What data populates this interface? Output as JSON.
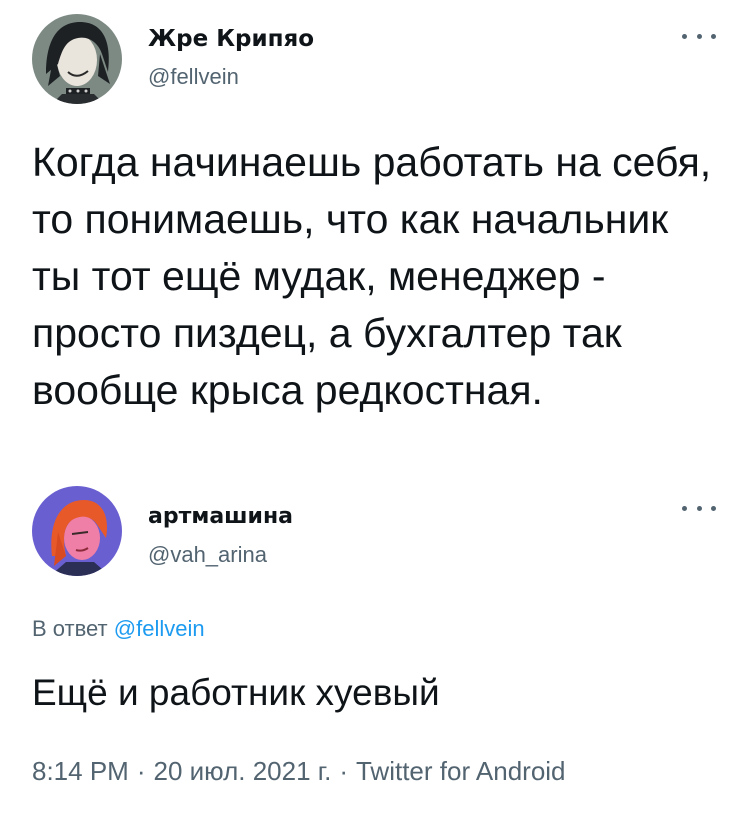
{
  "tweet": {
    "author": {
      "display_name": "Жре Крипяо",
      "handle": "@fellvein",
      "avatar_icon": "avatar-dark-haired-character"
    },
    "more_icon": "more-options-dots-icon",
    "text": "Когда начинаешь работать на себя, то понимаешь, что как начальник ты тот ещё мудак, менеджер - просто пиздец, а бухгалтер так вообще крыса редкостная."
  },
  "reply": {
    "author": {
      "display_name": "артмашина",
      "handle": "@vah_arina",
      "avatar_icon": "avatar-red-haired-character"
    },
    "more_icon": "more-options-dots-icon",
    "reply_prefix": "В ответ",
    "reply_mention": "@fellvein",
    "text": "Ещё и работник хуевый",
    "meta": {
      "time": "8:14 PM",
      "separator": "·",
      "date": "20 июл. 2021 г.",
      "source": "Twitter for Android"
    }
  },
  "colors": {
    "text_primary": "#0f1419",
    "text_secondary": "#536471",
    "link": "#1d9bf0",
    "background": "#ffffff"
  }
}
